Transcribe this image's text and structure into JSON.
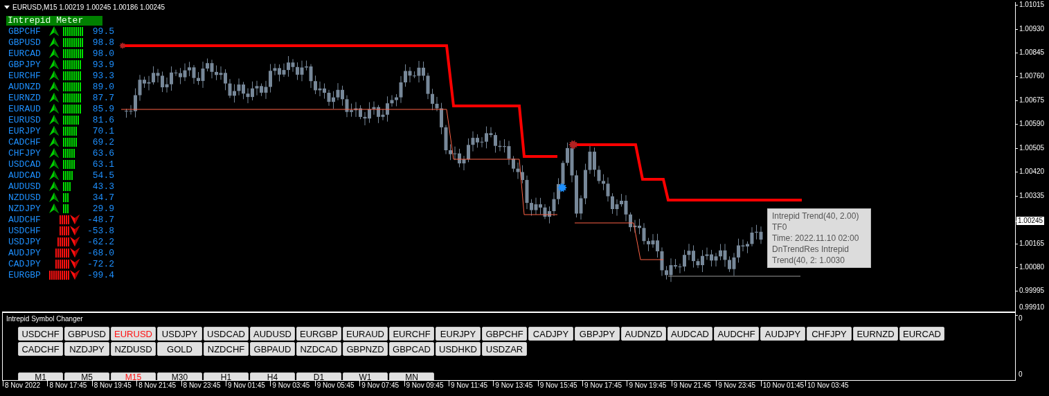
{
  "chart": {
    "title": "EURUSD,M15 1.00219 1.00245 1.00186 1.00245"
  },
  "meter": {
    "title": "Intrepid Meter",
    "rows": [
      {
        "symbol": "GBPCHF",
        "kind": "up",
        "value": "99.5"
      },
      {
        "symbol": "GBPUSD",
        "kind": "up",
        "value": "98.8"
      },
      {
        "symbol": "EURCAD",
        "kind": "up",
        "value": "98.0"
      },
      {
        "symbol": "GBPJPY",
        "kind": "up",
        "value": "93.9"
      },
      {
        "symbol": "EURCHF",
        "kind": "up",
        "value": "93.3"
      },
      {
        "symbol": "AUDNZD",
        "kind": "up",
        "value": "89.0"
      },
      {
        "symbol": "EURNZD",
        "kind": "up",
        "value": "87.7"
      },
      {
        "symbol": "EURAUD",
        "kind": "up",
        "value": "85.9"
      },
      {
        "symbol": "EURUSD",
        "kind": "up",
        "value": "81.6"
      },
      {
        "symbol": "EURJPY",
        "kind": "up",
        "value": "70.1"
      },
      {
        "symbol": "CADCHF",
        "kind": "up",
        "value": "69.2"
      },
      {
        "symbol": "CHFJPY",
        "kind": "up",
        "value": "63.6"
      },
      {
        "symbol": "USDCAD",
        "kind": "up",
        "value": "63.1"
      },
      {
        "symbol": "AUDCAD",
        "kind": "up",
        "value": "54.5"
      },
      {
        "symbol": "AUDUSD",
        "kind": "up",
        "value": "43.3"
      },
      {
        "symbol": "NZDUSD",
        "kind": "up",
        "value": "34.7"
      },
      {
        "symbol": "NZDJPY",
        "kind": "up",
        "value": "29.9"
      },
      {
        "symbol": "AUDCHF",
        "kind": "down",
        "value": "-48.7"
      },
      {
        "symbol": "USDCHF",
        "kind": "down",
        "value": "-53.8"
      },
      {
        "symbol": "USDJPY",
        "kind": "down",
        "value": "-62.2"
      },
      {
        "symbol": "AUDJPY",
        "kind": "down",
        "value": "-68.0"
      },
      {
        "symbol": "CADJPY",
        "kind": "down",
        "value": "-72.2"
      },
      {
        "symbol": "EURGBP",
        "kind": "down",
        "value": "-99.4"
      }
    ]
  },
  "tooltip": [
    "Intrepid Trend(40, 2.00)",
    "TF0",
    "Time: 2022.11.10 02:00",
    "DnTrendRes Intrepid",
    "Trend(40, 2: 1.0030"
  ],
  "price_axis": [
    {
      "label": "1.01015",
      "kind": "tick"
    },
    {
      "label": "1.00930",
      "kind": "tick"
    },
    {
      "label": "1.00845",
      "kind": "tick"
    },
    {
      "label": "1.00760",
      "kind": "tick"
    },
    {
      "label": "1.00675",
      "kind": "tick"
    },
    {
      "label": "1.00590",
      "kind": "tick"
    },
    {
      "label": "1.00505",
      "kind": "tick"
    },
    {
      "label": "1.00420",
      "kind": "tick"
    },
    {
      "label": "1.00335",
      "kind": "tick"
    },
    {
      "label": "1.00245",
      "kind": "current"
    },
    {
      "label": "1.00165",
      "kind": "tick"
    },
    {
      "label": "1.00080",
      "kind": "tick"
    },
    {
      "label": "0.99995",
      "kind": "tick"
    },
    {
      "label": "0.99910",
      "kind": "tick"
    }
  ],
  "symbol_changer": {
    "title": "Intrepid Symbol Changer",
    "symbols": [
      {
        "label": "USDCHF",
        "selected": false
      },
      {
        "label": "GBPUSD",
        "selected": false
      },
      {
        "label": "EURUSD",
        "selected": true
      },
      {
        "label": "USDJPY",
        "selected": false
      },
      {
        "label": "USDCAD",
        "selected": false
      },
      {
        "label": "AUDUSD",
        "selected": false
      },
      {
        "label": "EURGBP",
        "selected": false
      },
      {
        "label": "EURAUD",
        "selected": false
      },
      {
        "label": "EURCHF",
        "selected": false
      },
      {
        "label": "EURJPY",
        "selected": false
      },
      {
        "label": "GBPCHF",
        "selected": false
      },
      {
        "label": "CADJPY",
        "selected": false
      },
      {
        "label": "GBPJPY",
        "selected": false
      },
      {
        "label": "AUDNZD",
        "selected": false
      },
      {
        "label": "AUDCAD",
        "selected": false
      },
      {
        "label": "AUDCHF",
        "selected": false
      },
      {
        "label": "AUDJPY",
        "selected": false
      },
      {
        "label": "CHFJPY",
        "selected": false
      },
      {
        "label": "EURNZD",
        "selected": false
      },
      {
        "label": "EURCAD",
        "selected": false
      },
      {
        "label": "CADCHF",
        "selected": false
      },
      {
        "label": "NZDJPY",
        "selected": false
      },
      {
        "label": "NZDUSD",
        "selected": false
      },
      {
        "label": "GOLD",
        "selected": false
      },
      {
        "label": "NZDCHF",
        "selected": false
      },
      {
        "label": "GBPAUD",
        "selected": false
      },
      {
        "label": "NZDCAD",
        "selected": false
      },
      {
        "label": "GBPNZD",
        "selected": false
      },
      {
        "label": "GBPCAD",
        "selected": false
      },
      {
        "label": "USDHKD",
        "selected": false
      },
      {
        "label": "USDZAR",
        "selected": false
      }
    ],
    "timeframes": [
      {
        "label": "M1",
        "selected": false
      },
      {
        "label": "M5",
        "selected": false
      },
      {
        "label": "M15",
        "selected": true
      },
      {
        "label": "M30",
        "selected": false
      },
      {
        "label": "H1",
        "selected": false
      },
      {
        "label": "H4",
        "selected": false
      },
      {
        "label": "D1",
        "selected": false
      },
      {
        "label": "W1",
        "selected": false
      },
      {
        "label": "MN",
        "selected": false
      }
    ],
    "axis": [
      "0",
      "0"
    ]
  },
  "time_axis": [
    "8 Nov 2022",
    "8 Nov 17:45",
    "8 Nov 19:45",
    "8 Nov 21:45",
    "8 Nov 23:45",
    "9 Nov 01:45",
    "9 Nov 03:45",
    "9 Nov 05:45",
    "9 Nov 07:45",
    "9 Nov 09:45",
    "9 Nov 11:45",
    "9 Nov 13:45",
    "9 Nov 15:45",
    "9 Nov 17:45",
    "9 Nov 19:45",
    "9 Nov 21:45",
    "9 Nov 23:45",
    "10 Nov 01:45",
    "10 Nov 03:45"
  ]
}
